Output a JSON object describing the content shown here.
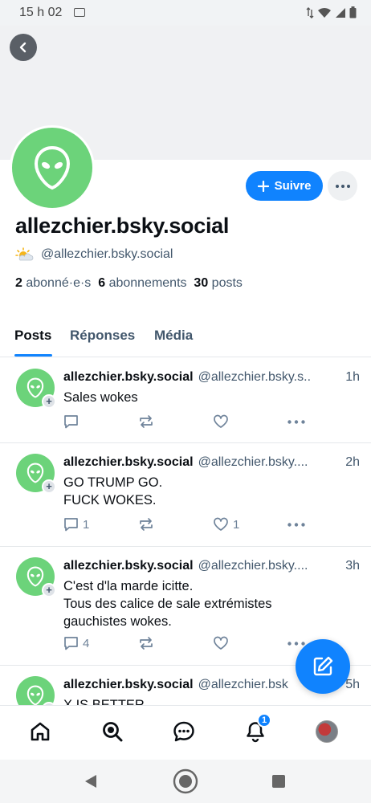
{
  "status_bar": {
    "time": "15 h 02"
  },
  "profile": {
    "display_name": "allezchier.bsky.social",
    "handle": "@allezchier.bsky.social",
    "handle_emoji": "🌥️",
    "follow_label": "Suivre",
    "followers_count": "2",
    "followers_label": "abonné·e·s",
    "following_count": "6",
    "following_label": "abonnements",
    "posts_count": "30",
    "posts_label": "posts"
  },
  "tabs": [
    {
      "label": "Posts",
      "active": true
    },
    {
      "label": "Réponses",
      "active": false
    },
    {
      "label": "Média",
      "active": false
    }
  ],
  "posts": [
    {
      "author": "allezchier.bsky.social",
      "handle": "@allezchier.bsky.s..",
      "time": "1h",
      "lines": [
        "Sales wokes"
      ],
      "reply_count": "",
      "like_count": ""
    },
    {
      "author": "allezchier.bsky.social",
      "handle": "@allezchier.bsky....",
      "time": "2h",
      "lines": [
        "GO TRUMP GO.",
        "FUCK WOKES."
      ],
      "reply_count": "1",
      "like_count": "1"
    },
    {
      "author": "allezchier.bsky.social",
      "handle": "@allezchier.bsky....",
      "time": "3h",
      "lines": [
        "C'est d'la marde icitte.",
        "Tous des calice de sale extrémistes",
        "gauchistes wokes."
      ],
      "reply_count": "4",
      "like_count": ""
    },
    {
      "author": "allezchier.bsky.social",
      "handle": "@allezchier.bsk",
      "time": "5h",
      "lines": [
        "X IS BETTER"
      ],
      "reply_count": "",
      "like_count": ""
    }
  ],
  "bottom_nav": {
    "items": [
      "home-icon",
      "search-icon",
      "chat-icon",
      "notifications-icon",
      "profile-avatar"
    ],
    "notification_badge": "1"
  },
  "colors": {
    "accent": "#1083fe",
    "avatar_green": "#6cd37a",
    "muted_text": "#42576c"
  }
}
